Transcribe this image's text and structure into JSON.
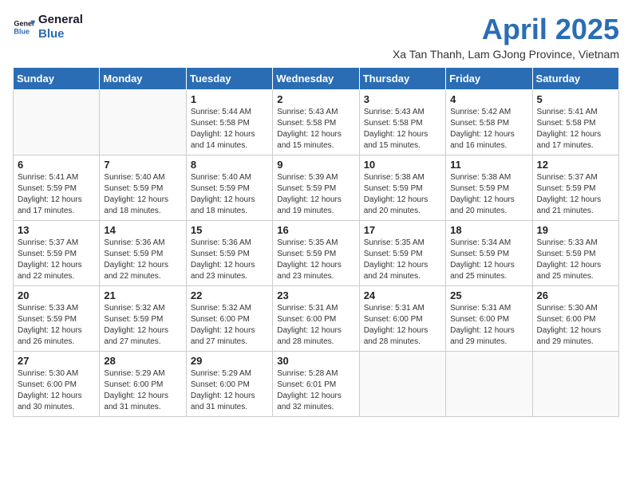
{
  "logo": {
    "line1": "General",
    "line2": "Blue"
  },
  "title": "April 2025",
  "subtitle": "Xa Tan Thanh, Lam GJong Province, Vietnam",
  "days_of_week": [
    "Sunday",
    "Monday",
    "Tuesday",
    "Wednesday",
    "Thursday",
    "Friday",
    "Saturday"
  ],
  "weeks": [
    [
      {
        "day": "",
        "text": ""
      },
      {
        "day": "",
        "text": ""
      },
      {
        "day": "1",
        "text": "Sunrise: 5:44 AM\nSunset: 5:58 PM\nDaylight: 12 hours and 14 minutes."
      },
      {
        "day": "2",
        "text": "Sunrise: 5:43 AM\nSunset: 5:58 PM\nDaylight: 12 hours and 15 minutes."
      },
      {
        "day": "3",
        "text": "Sunrise: 5:43 AM\nSunset: 5:58 PM\nDaylight: 12 hours and 15 minutes."
      },
      {
        "day": "4",
        "text": "Sunrise: 5:42 AM\nSunset: 5:58 PM\nDaylight: 12 hours and 16 minutes."
      },
      {
        "day": "5",
        "text": "Sunrise: 5:41 AM\nSunset: 5:58 PM\nDaylight: 12 hours and 17 minutes."
      }
    ],
    [
      {
        "day": "6",
        "text": "Sunrise: 5:41 AM\nSunset: 5:59 PM\nDaylight: 12 hours and 17 minutes."
      },
      {
        "day": "7",
        "text": "Sunrise: 5:40 AM\nSunset: 5:59 PM\nDaylight: 12 hours and 18 minutes."
      },
      {
        "day": "8",
        "text": "Sunrise: 5:40 AM\nSunset: 5:59 PM\nDaylight: 12 hours and 18 minutes."
      },
      {
        "day": "9",
        "text": "Sunrise: 5:39 AM\nSunset: 5:59 PM\nDaylight: 12 hours and 19 minutes."
      },
      {
        "day": "10",
        "text": "Sunrise: 5:38 AM\nSunset: 5:59 PM\nDaylight: 12 hours and 20 minutes."
      },
      {
        "day": "11",
        "text": "Sunrise: 5:38 AM\nSunset: 5:59 PM\nDaylight: 12 hours and 20 minutes."
      },
      {
        "day": "12",
        "text": "Sunrise: 5:37 AM\nSunset: 5:59 PM\nDaylight: 12 hours and 21 minutes."
      }
    ],
    [
      {
        "day": "13",
        "text": "Sunrise: 5:37 AM\nSunset: 5:59 PM\nDaylight: 12 hours and 22 minutes."
      },
      {
        "day": "14",
        "text": "Sunrise: 5:36 AM\nSunset: 5:59 PM\nDaylight: 12 hours and 22 minutes."
      },
      {
        "day": "15",
        "text": "Sunrise: 5:36 AM\nSunset: 5:59 PM\nDaylight: 12 hours and 23 minutes."
      },
      {
        "day": "16",
        "text": "Sunrise: 5:35 AM\nSunset: 5:59 PM\nDaylight: 12 hours and 23 minutes."
      },
      {
        "day": "17",
        "text": "Sunrise: 5:35 AM\nSunset: 5:59 PM\nDaylight: 12 hours and 24 minutes."
      },
      {
        "day": "18",
        "text": "Sunrise: 5:34 AM\nSunset: 5:59 PM\nDaylight: 12 hours and 25 minutes."
      },
      {
        "day": "19",
        "text": "Sunrise: 5:33 AM\nSunset: 5:59 PM\nDaylight: 12 hours and 25 minutes."
      }
    ],
    [
      {
        "day": "20",
        "text": "Sunrise: 5:33 AM\nSunset: 5:59 PM\nDaylight: 12 hours and 26 minutes."
      },
      {
        "day": "21",
        "text": "Sunrise: 5:32 AM\nSunset: 5:59 PM\nDaylight: 12 hours and 27 minutes."
      },
      {
        "day": "22",
        "text": "Sunrise: 5:32 AM\nSunset: 6:00 PM\nDaylight: 12 hours and 27 minutes."
      },
      {
        "day": "23",
        "text": "Sunrise: 5:31 AM\nSunset: 6:00 PM\nDaylight: 12 hours and 28 minutes."
      },
      {
        "day": "24",
        "text": "Sunrise: 5:31 AM\nSunset: 6:00 PM\nDaylight: 12 hours and 28 minutes."
      },
      {
        "day": "25",
        "text": "Sunrise: 5:31 AM\nSunset: 6:00 PM\nDaylight: 12 hours and 29 minutes."
      },
      {
        "day": "26",
        "text": "Sunrise: 5:30 AM\nSunset: 6:00 PM\nDaylight: 12 hours and 29 minutes."
      }
    ],
    [
      {
        "day": "27",
        "text": "Sunrise: 5:30 AM\nSunset: 6:00 PM\nDaylight: 12 hours and 30 minutes."
      },
      {
        "day": "28",
        "text": "Sunrise: 5:29 AM\nSunset: 6:00 PM\nDaylight: 12 hours and 31 minutes."
      },
      {
        "day": "29",
        "text": "Sunrise: 5:29 AM\nSunset: 6:00 PM\nDaylight: 12 hours and 31 minutes."
      },
      {
        "day": "30",
        "text": "Sunrise: 5:28 AM\nSunset: 6:01 PM\nDaylight: 12 hours and 32 minutes."
      },
      {
        "day": "",
        "text": ""
      },
      {
        "day": "",
        "text": ""
      },
      {
        "day": "",
        "text": ""
      }
    ]
  ]
}
